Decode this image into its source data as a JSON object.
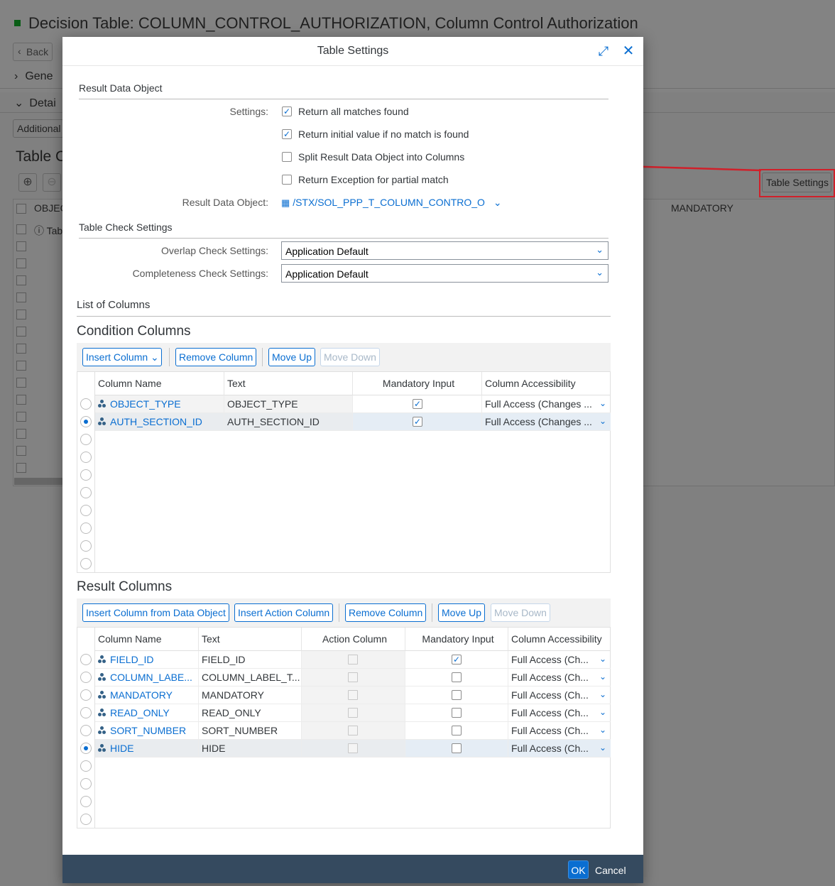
{
  "background": {
    "title": "Decision Table: COLUMN_CONTROL_AUTHORIZATION, Column Control Authorization",
    "back_label": "Back",
    "row_general": "Gene",
    "row_details": "Detai",
    "additional_label": "Additional",
    "table_contents_title": "Table C",
    "table_settings_button": "Table Settings",
    "col_object": "OBJEC",
    "col_mandatory": "MANDATORY",
    "table_row_text": "Tab"
  },
  "dialog": {
    "title": "Table Settings",
    "result_data_object": {
      "section_title": "Result Data Object",
      "settings_label": "Settings:",
      "options": [
        {
          "label": "Return all matches found",
          "checked": true
        },
        {
          "label": "Return initial value if no match is found",
          "checked": true
        },
        {
          "label": "Split Result Data Object into Columns",
          "checked": false
        },
        {
          "label": "Return Exception for partial match",
          "checked": false
        }
      ],
      "rdo_label": "Result Data Object:",
      "rdo_value": "/STX/SOL_PPP_T_COLUMN_CONTRO_O"
    },
    "table_check": {
      "section_title": "Table Check Settings",
      "overlap_label": "Overlap Check Settings:",
      "overlap_value": "Application Default",
      "completeness_label": "Completeness Check Settings:",
      "completeness_value": "Application Default"
    },
    "list_of_columns": "List of Columns",
    "condition": {
      "title": "Condition Columns",
      "buttons": {
        "insert": "Insert Column",
        "remove": "Remove Column",
        "up": "Move Up",
        "down": "Move Down"
      },
      "headers": [
        "Column Name",
        "Text",
        "Mandatory Input",
        "Column Accessibility"
      ],
      "rows": [
        {
          "name": "OBJECT_TYPE",
          "text": "OBJECT_TYPE",
          "mandatory": true,
          "access": "Full Access (Changes ...",
          "selected": false
        },
        {
          "name": "AUTH_SECTION_ID",
          "text": "AUTH_SECTION_ID",
          "mandatory": true,
          "access": "Full Access (Changes ...",
          "selected": true
        }
      ]
    },
    "result": {
      "title": "Result Columns",
      "buttons": {
        "insert_from": "Insert Column from Data Object",
        "insert_action": "Insert Action Column",
        "remove": "Remove Column",
        "up": "Move Up",
        "down": "Move Down"
      },
      "headers": [
        "Column Name",
        "Text",
        "Action Column",
        "Mandatory Input",
        "Column Accessibility"
      ],
      "rows": [
        {
          "name": "FIELD_ID",
          "text": "FIELD_ID",
          "mandatory": true,
          "access": "Full Access (Ch...",
          "selected": false
        },
        {
          "name": "COLUMN_LABE...",
          "text": "COLUMN_LABEL_T...",
          "mandatory": false,
          "access": "Full Access (Ch...",
          "selected": false
        },
        {
          "name": "MANDATORY",
          "text": "MANDATORY",
          "mandatory": false,
          "access": "Full Access (Ch...",
          "selected": false
        },
        {
          "name": "READ_ONLY",
          "text": "READ_ONLY",
          "mandatory": false,
          "access": "Full Access (Ch...",
          "selected": false
        },
        {
          "name": "SORT_NUMBER",
          "text": "SORT_NUMBER",
          "mandatory": false,
          "access": "Full Access (Ch...",
          "selected": false
        },
        {
          "name": "HIDE",
          "text": "HIDE",
          "mandatory": false,
          "access": "Full Access (Ch...",
          "selected": true
        }
      ]
    },
    "footer": {
      "ok": "OK",
      "cancel": "Cancel"
    }
  },
  "colors": {
    "accent": "#0a6ed1",
    "footer": "#354a5f",
    "highlight": "#d0202a"
  }
}
